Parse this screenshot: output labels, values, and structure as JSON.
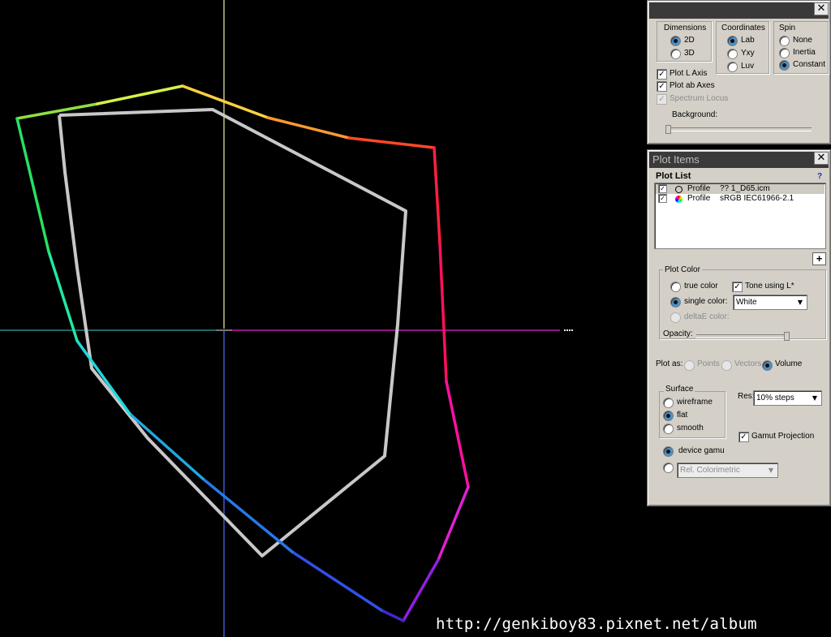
{
  "colors": {
    "background": "#000000",
    "panel_bg": "#d4d0c8",
    "title_bg": "#3a3a3a",
    "inner_gamut": "#d0d0d0",
    "l_axis": "#f2f2a0"
  },
  "display_panel": {
    "close_icon": "close-icon",
    "dimensions": {
      "title": "Dimensions",
      "options": [
        "2D",
        "3D"
      ],
      "selected": "2D"
    },
    "coordinates": {
      "title": "Coordinates",
      "options": [
        "Lab",
        "Yxy",
        "Luv"
      ],
      "selected": "Lab"
    },
    "spin": {
      "title": "Spin",
      "options": [
        "None",
        "Inertia",
        "Constant"
      ],
      "selected": "Constant"
    },
    "plot_l_axis": {
      "label": "Plot L Axis",
      "checked": true
    },
    "plot_ab_axes": {
      "label": "Plot ab Axes",
      "checked": true
    },
    "spectrum_locus": {
      "label": "Spectrum Locus",
      "checked": true,
      "disabled": true
    },
    "background_label": "Background:"
  },
  "plot_items_panel": {
    "title": "Plot Items",
    "close_icon": "close-icon",
    "plot_list_title": "Plot List",
    "help": "?",
    "items": [
      {
        "type": "Profile",
        "name": "?? 1_D65.icm",
        "checked": true,
        "icon": "circle-outline-icon"
      },
      {
        "type": "Profile",
        "name": "sRGB IEC61966-2.1",
        "checked": true,
        "icon": "color-wheel-icon"
      }
    ],
    "add_button": "+",
    "plot_color": {
      "title": "Plot Color",
      "true_color": "true color",
      "single_color": "single color:",
      "delta_e": "deltaE color:",
      "tone_label": "Tone using L*",
      "color_value": "White",
      "opacity_label": "Opacity:",
      "opacity": 0.9
    },
    "plot_as": {
      "label": "Plot as:",
      "options": [
        "Points",
        "Vectors",
        "Volume"
      ],
      "selected": "Volume"
    },
    "surface": {
      "title": "Surface",
      "options": [
        "wireframe",
        "flat",
        "smooth"
      ],
      "selected": "flat"
    },
    "res_label": "Res:",
    "res_value": "10% steps",
    "gamut_projection": {
      "label": "Gamut Projection",
      "checked": true
    },
    "device_gamut": "device gamu",
    "rendering_intent": "Rel. Colorimetric"
  },
  "watermark": "http://genkiboy83.pixnet.net/album"
}
